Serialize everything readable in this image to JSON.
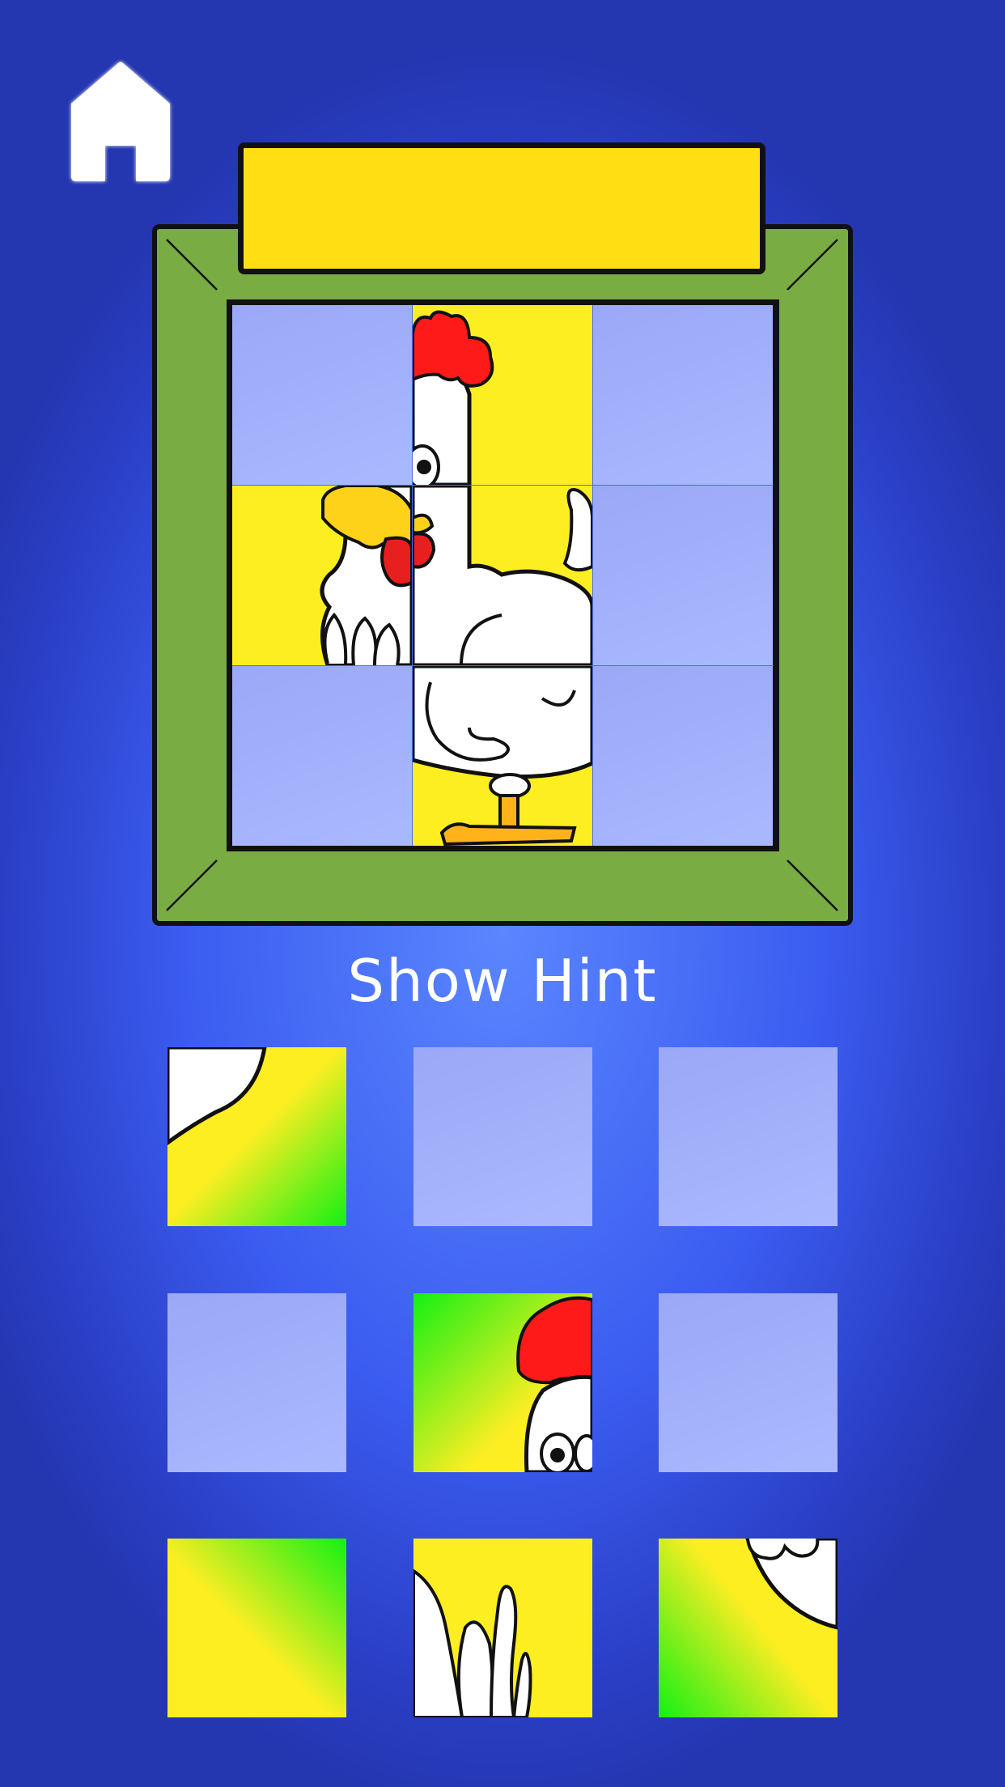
{
  "app": {
    "title": ""
  },
  "home_button": {
    "icon": "house-icon"
  },
  "title_plate": {
    "text": ""
  },
  "hint": {
    "label": "Show Hint"
  },
  "colors": {
    "frame_green": "#7aac44",
    "title_plate_yellow": "#ffde14",
    "empty_slot": "#a3b2fb",
    "background_blue": "#3b5cf0",
    "comb_red": "#ff1a1a",
    "beak_yellow": "#ffd21a"
  },
  "board": {
    "rows": 3,
    "cols": 3,
    "placed_pieces": [
      "top-middle",
      "middle-left",
      "middle-middle",
      "bottom-middle"
    ],
    "empty_slots": [
      "top-left",
      "top-right",
      "middle-right",
      "bottom-left",
      "bottom-right"
    ]
  },
  "tray": {
    "slots": [
      {
        "piece": "tail-edge-piece"
      },
      {
        "piece": "empty"
      },
      {
        "piece": "empty"
      },
      {
        "piece": "empty"
      },
      {
        "piece": "comb-and-eyes-piece"
      },
      {
        "piece": "empty"
      },
      {
        "piece": "yellow-green-gradient-piece"
      },
      {
        "piece": "wing-fingers-piece"
      },
      {
        "piece": "body-bottom-right-piece"
      }
    ]
  }
}
